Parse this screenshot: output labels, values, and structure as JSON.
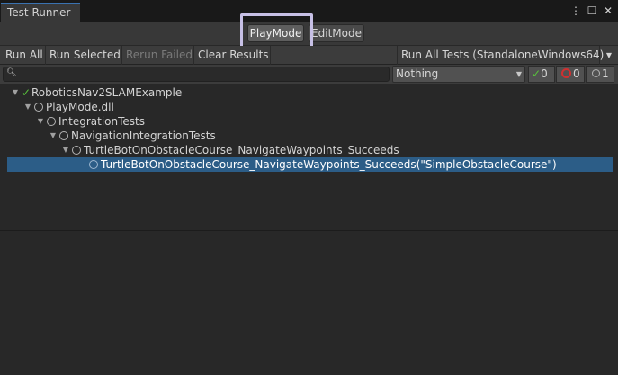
{
  "window": {
    "tab_title": "Test Runner",
    "menu_icon": "⋮",
    "maximize_icon": "☐",
    "close_icon": "✕"
  },
  "modes": {
    "play": "PlayMode",
    "edit": "EditMode"
  },
  "toolbar": {
    "run_all": "Run All",
    "run_selected": "Run Selected",
    "rerun_failed": "Rerun Failed",
    "clear_results": "Clear Results",
    "run_all_tests": "Run All Tests (StandaloneWindows64)"
  },
  "filter": {
    "search_value": "",
    "category": "Nothing",
    "passed_count": "0",
    "failed_count": "0",
    "skipped_count": "1"
  },
  "tree": [
    {
      "label": "RoboticsNav2SLAMExample",
      "status": "passed",
      "expanded": true
    },
    {
      "label": "PlayMode.dll",
      "status": "none",
      "expanded": true
    },
    {
      "label": "IntegrationTests",
      "status": "none",
      "expanded": true
    },
    {
      "label": "NavigationIntegrationTests",
      "status": "none",
      "expanded": true
    },
    {
      "label": "TurtleBotOnObstacleCourse_NavigateWaypoints_Succeeds",
      "status": "none",
      "expanded": true
    },
    {
      "label": "TurtleBotOnObstacleCourse_NavigateWaypoints_Succeeds(\"SimpleObstacleCourse\")",
      "status": "none",
      "selected": true
    }
  ],
  "colors": {
    "selection": "#2c5d87",
    "passed": "#58c13c",
    "failed": "#d03030",
    "highlight": "#c7c0e6"
  }
}
